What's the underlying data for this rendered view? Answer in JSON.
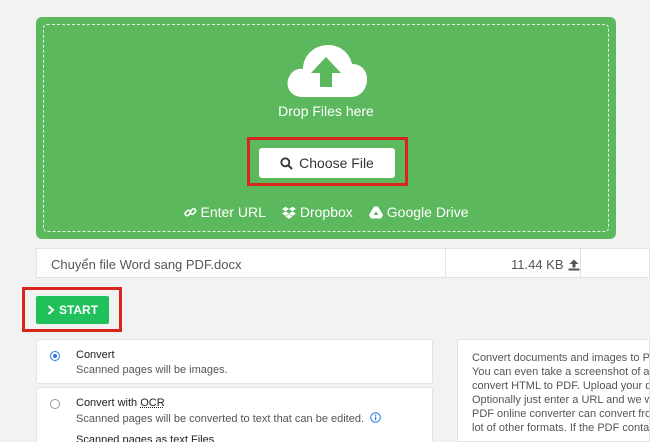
{
  "upload": {
    "drop_label": "Drop Files here",
    "choose_label": "Choose File",
    "links": {
      "enter_url": "Enter URL",
      "dropbox": "Dropbox",
      "google_drive": "Google Drive"
    },
    "icons": [
      "cloud-upload-icon",
      "search-icon",
      "link-icon",
      "dropbox-icon",
      "google-drive-icon"
    ]
  },
  "file": {
    "name": "Chuyển file Word sang PDF.docx",
    "size": "11.44 KB"
  },
  "start_label": "START",
  "options": {
    "convert": {
      "title": "Convert",
      "desc": "Scanned pages will be images."
    },
    "convert_ocr": {
      "title_prefix": "Convert with ",
      "title_ocr": "OCR",
      "desc": "Scanned pages will be converted to text that can be edited."
    },
    "partial_label": "Scanned pages as text Files"
  },
  "info": {
    "lines": [
      "Convert documents and images to P",
      "You can even take a screenshot of a w",
      "convert HTML to PDF. Upload your do",
      "Optionally just enter a URL and we w",
      "PDF online converter can convert fro",
      "lot of other formats. If the PDF conta"
    ]
  },
  "colors": {
    "upload_green": "#5cb85c",
    "start_green": "#20c05a",
    "highlight_red": "#d9251c",
    "radio_blue": "#2a7ae2"
  }
}
